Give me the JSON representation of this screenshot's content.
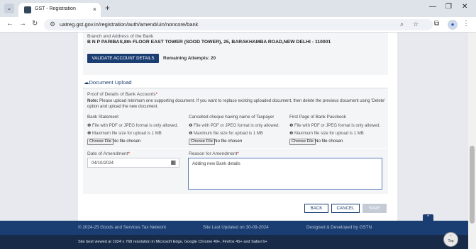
{
  "browser": {
    "tab_title": "GST - Registration",
    "tab_close": "×",
    "new_tab": "+",
    "menu_glyph": "⌄",
    "url": "uatreg.gst.gov.in/registration/auth/amend/uin/noncore/bank",
    "minimize": "—",
    "restore": "❐",
    "close": "✕"
  },
  "bank": {
    "address_label": "Branch and Address of the Bank",
    "address_value": "B N P PARIBAS,8th FLOOR EAST TOWER (SOOD TOWER), 25, BARAKHAMBA ROAD,NEW DELHI - 110001",
    "validate_button": "VALIDATE ACCOUNT DETAILS",
    "remaining_attempts": "Remaining Attempts: 20"
  },
  "upload": {
    "section_title": "Document Upload",
    "proof_label": "Proof of Details of Bank Accounts",
    "required_mark": "*",
    "note_bold": "Note:",
    "note_text": "Please upload minimum one supporting document. If you want to replace existing uploaded document, then delete the previous document using 'Delete' option and upload the new document.",
    "columns": [
      {
        "heading": "Bank Statement",
        "format_info": "File with PDF or JPEG format is only allowed.",
        "size_info": "Maximum file size for upload is 1 MB",
        "choose_label": "Choose File",
        "no_file": "No file chosen"
      },
      {
        "heading": "Cancelled cheque having name of Taxpayer",
        "format_info": "File with PDF or JPEG format is only allowed.",
        "size_info": "Maximum file size for upload is 1 MB",
        "choose_label": "Choose File",
        "no_file": "No file chosen"
      },
      {
        "heading": "First Page of Bank Passbook",
        "format_info": "File with PDF or JPEG format is only allowed.",
        "size_info": "Maximum file size for upload is 1 MB",
        "choose_label": "Choose File",
        "no_file": "No file chosen"
      }
    ]
  },
  "amendment": {
    "date_label": "Date of Amendment",
    "date_value": "04/10/2024",
    "reason_label": "Reason for Amendment",
    "reason_value": "Adding new Bank details",
    "required_mark": "*"
  },
  "actions": {
    "back": "BACK",
    "cancel": "CANCEL",
    "save": "SAVE"
  },
  "footer": {
    "copyright": "© 2024-25 Goods and Services Tax Network",
    "last_updated": "Site Last Updated on 30-09-2024",
    "designed_by": "Designed & Developed by GSTN",
    "best_viewed": "Site best viewed at 1024 x 768 resolution in Microsoft Edge, Google Chrome 49+, Firefox 45+ and Safari 6+",
    "top_label": "Top"
  }
}
